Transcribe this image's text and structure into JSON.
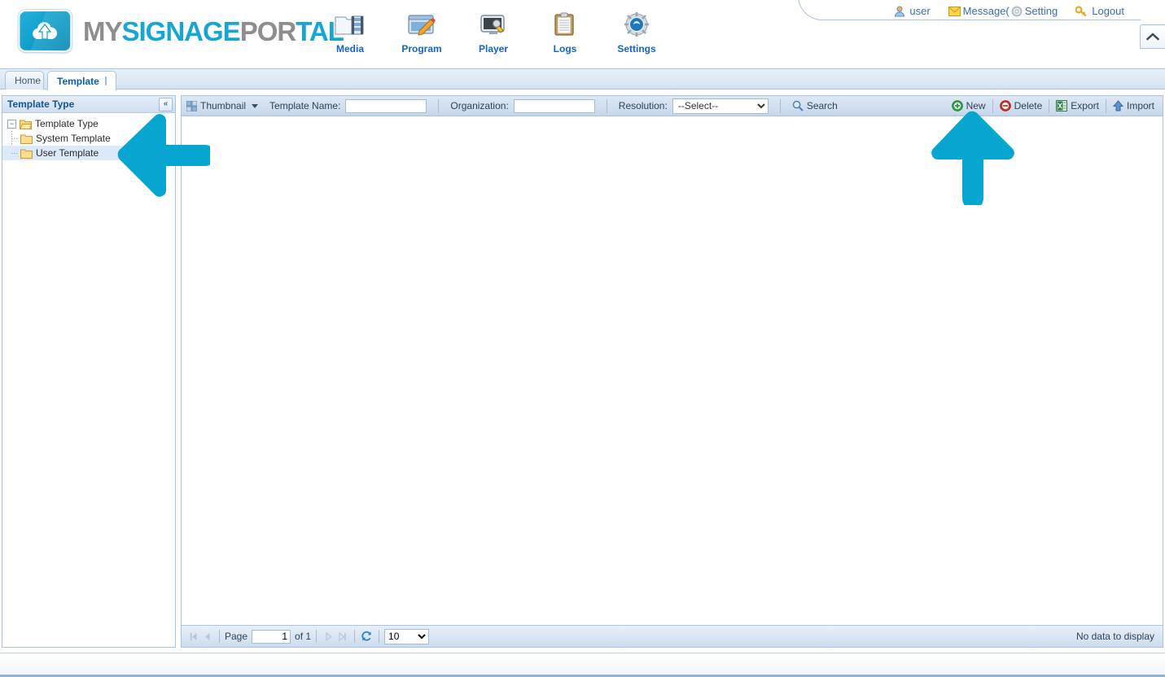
{
  "app": {
    "brand": {
      "word1": "MY",
      "word2": "SIGNAGE",
      "word3": "POR",
      "word4": "TAL",
      "logo_icon": "cloud-upload-icon",
      "accent_color": "#17a6d4"
    },
    "nav": [
      {
        "label": "Media",
        "icon": "media-folder-film-icon"
      },
      {
        "label": "Program",
        "icon": "program-window-pencil-icon"
      },
      {
        "label": "Player",
        "icon": "player-monitor-wrench-icon"
      },
      {
        "label": "Logs",
        "icon": "logs-clipboard-icon"
      },
      {
        "label": "Settings",
        "icon": "settings-gear-icon"
      }
    ],
    "userbar": [
      {
        "label": "user",
        "icon": "user-icon"
      },
      {
        "label": "Message(",
        "icon": "envelope-icon"
      },
      {
        "label": "Setting",
        "icon": "gear-small-icon"
      },
      {
        "label": "Logout",
        "icon": "key-icon"
      }
    ],
    "collapse_header_icon": "chevron-up-icon"
  },
  "tabs": [
    {
      "label": "Home",
      "active": false,
      "closable": false
    },
    {
      "label": "Template",
      "active": true,
      "closable": true
    }
  ],
  "sidebar": {
    "title": "Template Type",
    "collapse_icon": "double-chevron-left-icon",
    "tree": {
      "root": {
        "label": "Template Type",
        "expanded": true,
        "icon": "folder-open-icon"
      },
      "children": [
        {
          "label": "System Template",
          "icon": "folder-icon",
          "selected": false
        },
        {
          "label": "User Template",
          "icon": "folder-icon",
          "selected": true
        }
      ]
    }
  },
  "toolbar": {
    "view_mode": "Thumbnail",
    "view_mode_icon": "thumbnail-grid-icon",
    "template_name_label": "Template Name:",
    "template_name_value": "",
    "organization_label": "Organization:",
    "organization_value": "",
    "resolution_label": "Resolution:",
    "resolution_selected": "--Select--",
    "resolution_options": [
      "--Select--"
    ],
    "search_label": "Search",
    "search_icon": "magnifier-icon",
    "actions": [
      {
        "label": "New",
        "icon": "plus-circle-green-icon"
      },
      {
        "label": "Delete",
        "icon": "minus-circle-red-icon"
      },
      {
        "label": "Export",
        "icon": "excel-sheet-icon"
      },
      {
        "label": "Import",
        "icon": "up-arrow-blue-icon"
      }
    ]
  },
  "grid": {
    "empty_message": "No data to display"
  },
  "pager": {
    "first_icon": "first-page-icon",
    "prev_icon": "prev-page-icon",
    "page_label": "Page",
    "page_value": "1",
    "of_label": "of 1",
    "next_icon": "next-page-icon",
    "last_icon": "last-page-icon",
    "refresh_icon": "refresh-icon",
    "page_size_selected": "10",
    "page_size_options": [
      "10"
    ]
  },
  "annotations": {
    "arrow_color": "#07a6d0",
    "items": [
      {
        "name": "arrow-pointing-to-user-template",
        "direction": "left"
      },
      {
        "name": "arrow-pointing-to-new-button",
        "direction": "up"
      }
    ]
  }
}
